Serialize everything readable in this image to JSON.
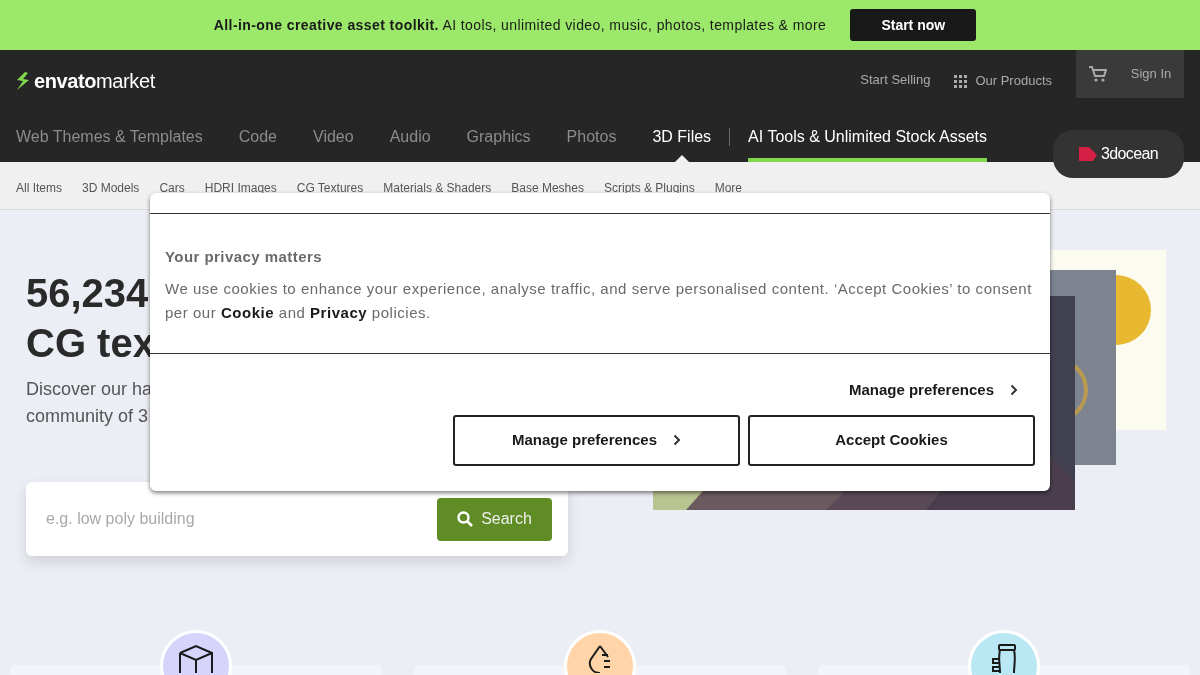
{
  "banner": {
    "text": "**All-in-one creative asset toolkit.** AI tools, unlimited video, music, photos, templates & more",
    "button": "Start now"
  },
  "header": {
    "logo_word": "envato",
    "logo_suffix": "market",
    "links": [
      {
        "label": "Start Selling",
        "kind": "text"
      },
      {
        "label": "Our Products",
        "kind": "grid"
      }
    ],
    "sign_in": "Sign In"
  },
  "categories": [
    {
      "label": "Web Themes & Templates",
      "selected": false
    },
    {
      "label": "Code",
      "selected": false
    },
    {
      "label": "Video",
      "selected": false
    },
    {
      "label": "Audio",
      "selected": false
    },
    {
      "label": "Graphics",
      "selected": false
    },
    {
      "label": "Photos",
      "selected": false
    },
    {
      "label": "3D Files",
      "selected": true
    }
  ],
  "ai_link": "AI Tools & Unlimited Stock Assets",
  "site_badge": "3docean",
  "subnav": [
    "All Items",
    "3D Models",
    "Cars",
    "HDRI Images",
    "CG Textures",
    "Materials & Shaders",
    "Base Meshes",
    "Scripts & Plugins",
    "More"
  ],
  "hero": {
    "title_lines": [
      "56,234",
      "CG tex"
    ],
    "description_lines": [
      "Discover our ha",
      "community of 3"
    ],
    "search": {
      "placeholder": "e.g. low poly building",
      "button": "Search"
    }
  },
  "features": [
    {
      "kind": "cube",
      "color": "#d6d4fb"
    },
    {
      "kind": "drop",
      "color": "#ffd4a8"
    },
    {
      "kind": "jar",
      "color": "#b9e8f4"
    }
  ],
  "consent": {
    "title": "Your privacy matters",
    "body": "We use cookies to enhance your experience, analyse traffic, and serve personalised content. ‘Accept Cookies’ to consent per our **Cookie** and **Privacy** policies.",
    "link": "Manage preferences",
    "buttons": [
      "Manage preferences",
      "Accept Cookies"
    ]
  }
}
